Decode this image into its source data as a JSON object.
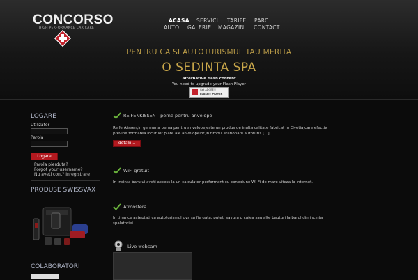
{
  "header": {
    "logo": "CONCORSO",
    "logo_tagline": "HIGH PERFORMANCE CAR CARE",
    "nav": [
      "ACASA",
      "SERVICII",
      "TARIFE",
      "PARC",
      "AUTO",
      "GALERIE",
      "MAGAZIN",
      "CONTACT"
    ],
    "active_nav": "ACASA",
    "slogan_line1": "PENTRU CA SI AUTOTURISMUL TAU MERITA",
    "slogan_line2": "O SEDINTA SPA",
    "flash_title": "Alternative flash content",
    "flash_message": "You need to upgrade your Flash Player",
    "flash_button_line1": "Get ADOBE®",
    "flash_button_line2": "FLASH® PLAYER"
  },
  "sidebar": {
    "login_heading": "LOGARE",
    "user_label": "Utilizator",
    "password_label": "Parola",
    "login_button": "Logare",
    "links": [
      "Parola pierduta?",
      "Forgot your username?",
      "Nu aveti cont? Inregistrare"
    ],
    "products_heading": "PRODUSE SWISSVAX",
    "partners_heading": "COLABORATORI"
  },
  "articles": [
    {
      "title": "REIFENKISSEN - perne pentru anvelope",
      "body": "Reifenkissen,in germana perna pentru anvelope,este un produs de inalta calitate fabricat in Elvetia,care efectiv previne formarea locurilor plate ale anvelopelor,in timpul stationarii autoturis [...]",
      "more": "detalii..."
    },
    {
      "title": "WiFi gratuit",
      "body": "In incinta barului aveti access la un calculator performant cu conexiune Wi-Fi de mare viteza la internet."
    },
    {
      "title": "Atmosfera",
      "body": "In timp ce asteptati ca autoturismul dvs sa fie gata, puteti savura o cafea sau alte bauturi la barul din incinta spalatoriei."
    },
    {
      "title": "Live webcam"
    }
  ],
  "colors": {
    "accent_red": "#c2212b",
    "gold": "#c9a74a",
    "check_green": "#6ab33c"
  }
}
